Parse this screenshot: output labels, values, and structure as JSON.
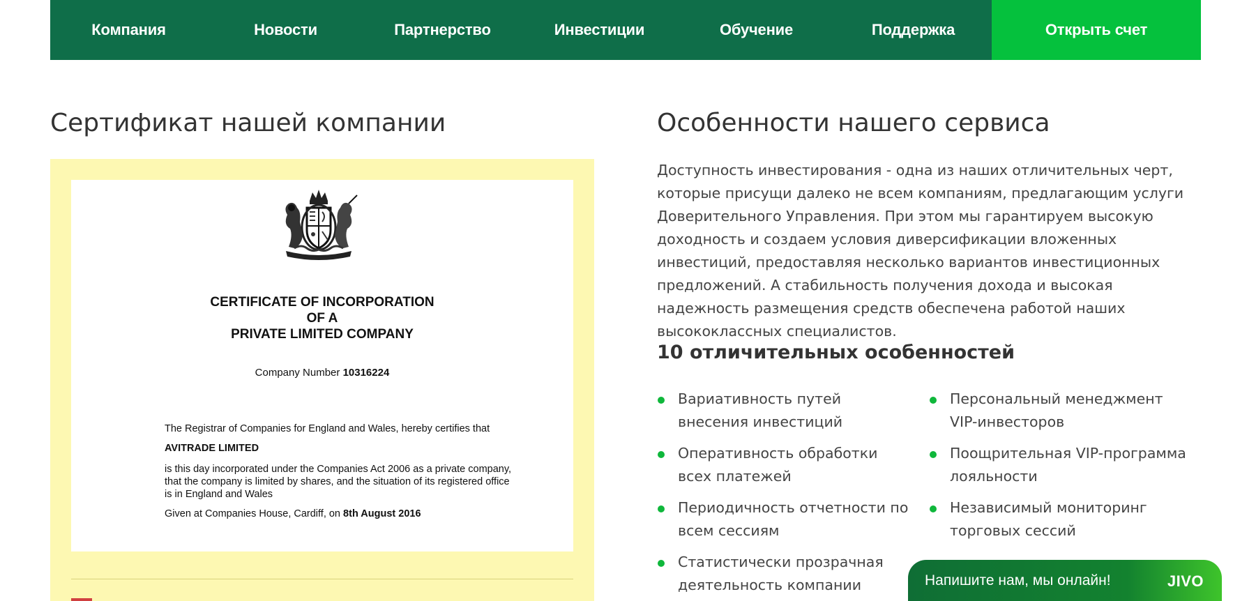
{
  "nav": {
    "items": [
      "Компания",
      "Новости",
      "Партнерство",
      "Инвестиции",
      "Обучение",
      "Поддержка"
    ],
    "cta": "Открыть счет"
  },
  "certificate": {
    "title": "Сертификат нашей компании",
    "heading_line1": "CERTIFICATE OF INCORPORATION",
    "heading_line2": "OF A",
    "heading_line3": "PRIVATE LIMITED COMPANY",
    "number_label": "Company Number",
    "number_value": "10316224",
    "registrar_text": "The Registrar of Companies for England and Wales, hereby certifies that",
    "company_name": "AVITRADE LIMITED",
    "incorporated_text": "is this day incorporated under the Companies Act 2006 as a private company, that the company is limited by shares, and the situation of its registered office is in England and Wales",
    "given_text": "Given at Companies House, Cardiff, on",
    "given_date": "8th August 2016"
  },
  "features": {
    "title": "Особенности нашего сервиса",
    "description": "Доступность инвестирования - одна из наших отличительных черт, которые присущи далеко не всем компаниям, предлагающим услуги Доверительного Управления. При этом мы гарантируем высокую доходность и создаем условия диверсификации вложенных инвестиций, предоставляя несколько вариантов инвестиционных предложений. А стабильность получения дохода и высокая надежность размещения средств обеспечена работой наших высококлассных специалистов.",
    "subtitle": "10 отличительных особенностей",
    "col1": [
      "Вариативность путей внесения инвестиций",
      "Оперативность обработки всех платежей",
      "Периодичность отчетности по всем сессиям",
      "Статистически прозрачная деятельность компании"
    ],
    "col2": [
      "Персональный менеджмент VIP-инвесторов",
      "Поощрительная VIP-программа лояльности",
      "Независимый мониторинг торговых сессий"
    ]
  },
  "chat": {
    "label": "Напишите нам, мы онлайн!",
    "logo": "JIVO"
  },
  "colors": {
    "nav_bg": "#0f6e49",
    "cta_bg": "#05c13d",
    "cert_bg": "#fdf8b2",
    "bullet": "#0fb73b"
  }
}
